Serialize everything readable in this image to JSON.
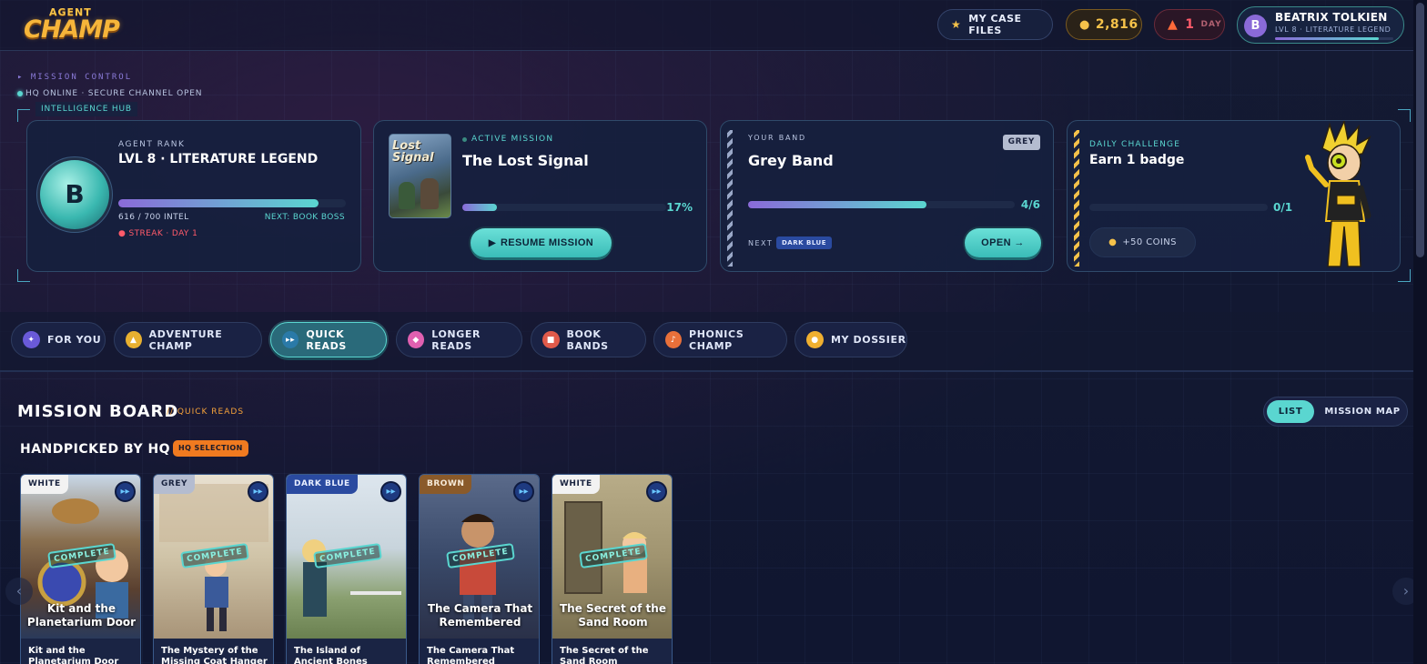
{
  "header": {
    "logo_top": "AGENT",
    "logo_bottom": "CHAMP",
    "case_files_label": "MY CASE FILES",
    "coins": "2,816",
    "streak_count": "1",
    "streak_unit": "DAY",
    "user": {
      "initial": "B",
      "name": "BEATRIX TOLKIEN",
      "level": "LVL 8 · LITERATURE LEGEND",
      "xp_progress": 0.88
    }
  },
  "mission_control": {
    "label": "▸ MISSION CONTROL",
    "status": "HQ ONLINE · SECURE CHANNEL OPEN",
    "hub_label": "INTELLIGENCE HUB"
  },
  "rank_card": {
    "initial": "B",
    "label": "AGENT RANK",
    "value": "LVL 8 · LITERATURE LEGEND",
    "intel": "616 / 700 INTEL",
    "next": "NEXT: BOOK BOSS",
    "streak": "● STREAK · DAY 1",
    "progress": 0.88
  },
  "active_mission": {
    "label": "ACTIVE MISSION",
    "title": "The Lost Signal",
    "cover_title": "Lost Signal",
    "percent": "17%",
    "progress": 0.17,
    "resume_label": "RESUME MISSION"
  },
  "band_card": {
    "label": "YOUR BAND",
    "value": "Grey Band",
    "badge": "GREY",
    "count": "4/6",
    "progress": 0.67,
    "next_label": "NEXT",
    "next_band": "DARK BLUE",
    "open_label": "OPEN →"
  },
  "daily_card": {
    "label": "DAILY CHALLENGE",
    "value": "Earn 1 badge",
    "count": "0/1",
    "progress": 0,
    "reward": "+50 COINS"
  },
  "tabs": [
    {
      "label": "FOR YOU",
      "color": "#6a5ad8"
    },
    {
      "label": "ADVENTURE CHAMP",
      "color": "#e8b030"
    },
    {
      "label": "QUICK READS",
      "color": "#2a7aa8"
    },
    {
      "label": "LONGER READS",
      "color": "#e060b0"
    },
    {
      "label": "BOOK BANDS",
      "color": "#e05a4a"
    },
    {
      "label": "PHONICS CHAMP",
      "color": "#e8703a"
    },
    {
      "label": "MY DOSSIER",
      "color": "#f0b030"
    }
  ],
  "mission_board": {
    "title": "MISSION BOARD",
    "subtitle": "// QUICK READS",
    "view_list": "LIST",
    "view_map": "MISSION MAP",
    "section_title": "HANDPICKED BY HQ",
    "section_badge": "HQ SELECTION",
    "books": [
      {
        "band": "WHITE",
        "band_bg": "#f2f2f2",
        "band_fg": "#1a2440",
        "status": "COMPLETE",
        "overlay_title": "Kit and the Planetarium Door",
        "title": "Kit and the Planetarium Door"
      },
      {
        "band": "GREY",
        "band_bg": "#b4bcd0",
        "band_fg": "#1a2440",
        "status": "COMPLETE",
        "overlay_title": "",
        "title": "The Mystery of the Missing Coat Hanger"
      },
      {
        "band": "DARK BLUE",
        "band_bg": "#2a4aa0",
        "band_fg": "#e8eeff",
        "status": "COMPLETE",
        "overlay_title": "",
        "title": "The Island of Ancient Bones"
      },
      {
        "band": "BROWN",
        "band_bg": "#8a5a2a",
        "band_fg": "#f6ead8",
        "status": "COMPLETE",
        "overlay_title": "The Camera That Remembered",
        "title": "The Camera That Remembered"
      },
      {
        "band": "WHITE",
        "band_bg": "#f2f2f2",
        "band_fg": "#1a2440",
        "status": "COMPLETE",
        "overlay_title": "The Secret of the Sand Room",
        "title": "The Secret of the Sand Room"
      }
    ]
  }
}
